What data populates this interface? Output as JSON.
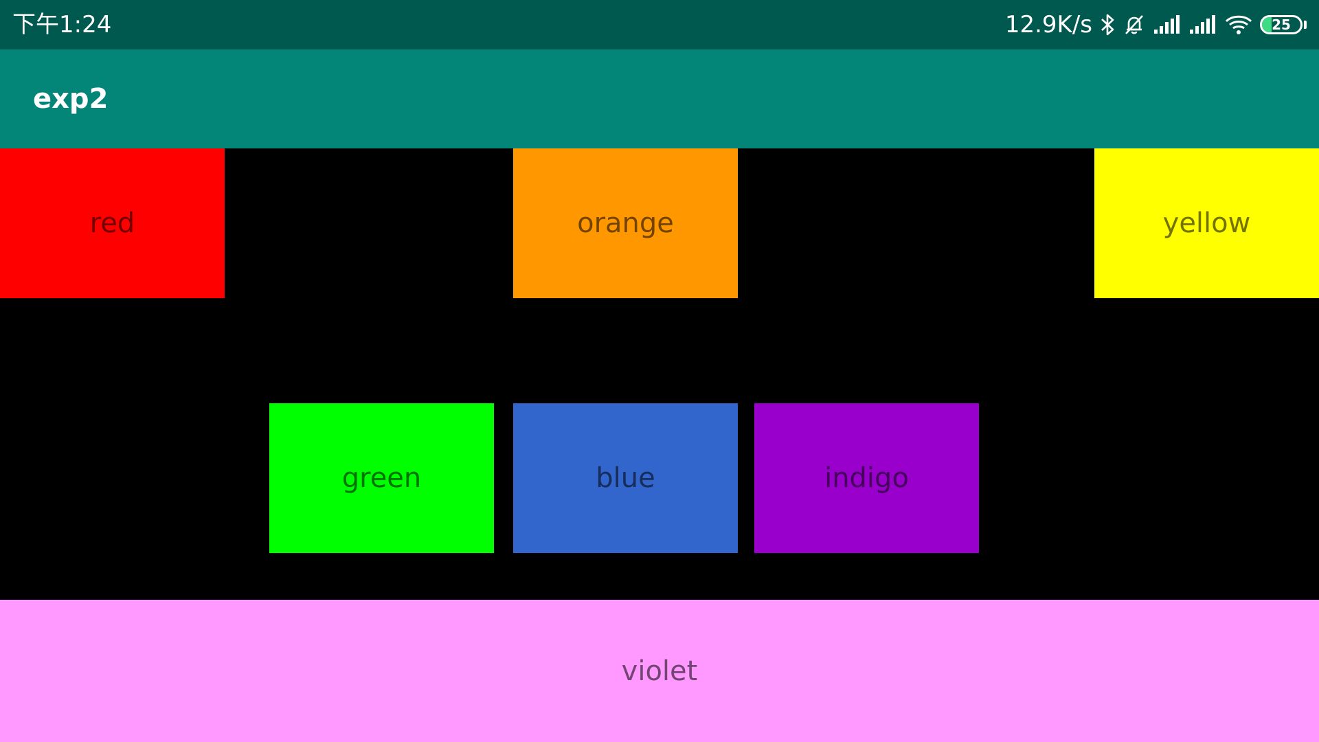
{
  "status_bar": {
    "time": "下午1:24",
    "net_speed": "12.9K/s",
    "icons": [
      "bluetooth-icon",
      "bell-off-icon",
      "signal-icon",
      "signal-icon",
      "wifi-icon",
      "battery-icon"
    ],
    "battery_level": "25",
    "battery_fraction": 0.25,
    "background": "#00594f"
  },
  "app_bar": {
    "title": "exp2",
    "background": "#038677"
  },
  "boxes": {
    "red": {
      "label": "red",
      "color": "#ff0000"
    },
    "orange": {
      "label": "orange",
      "color": "#ff9800"
    },
    "yellow": {
      "label": "yellow",
      "color": "#ffff00"
    },
    "green": {
      "label": "green",
      "color": "#00ff00"
    },
    "blue": {
      "label": "blue",
      "color": "#3366cc"
    },
    "indigo": {
      "label": "indigo",
      "color": "#9900cc"
    },
    "violet": {
      "label": "violet",
      "color": "#ff99ff"
    }
  },
  "background": "#000000"
}
